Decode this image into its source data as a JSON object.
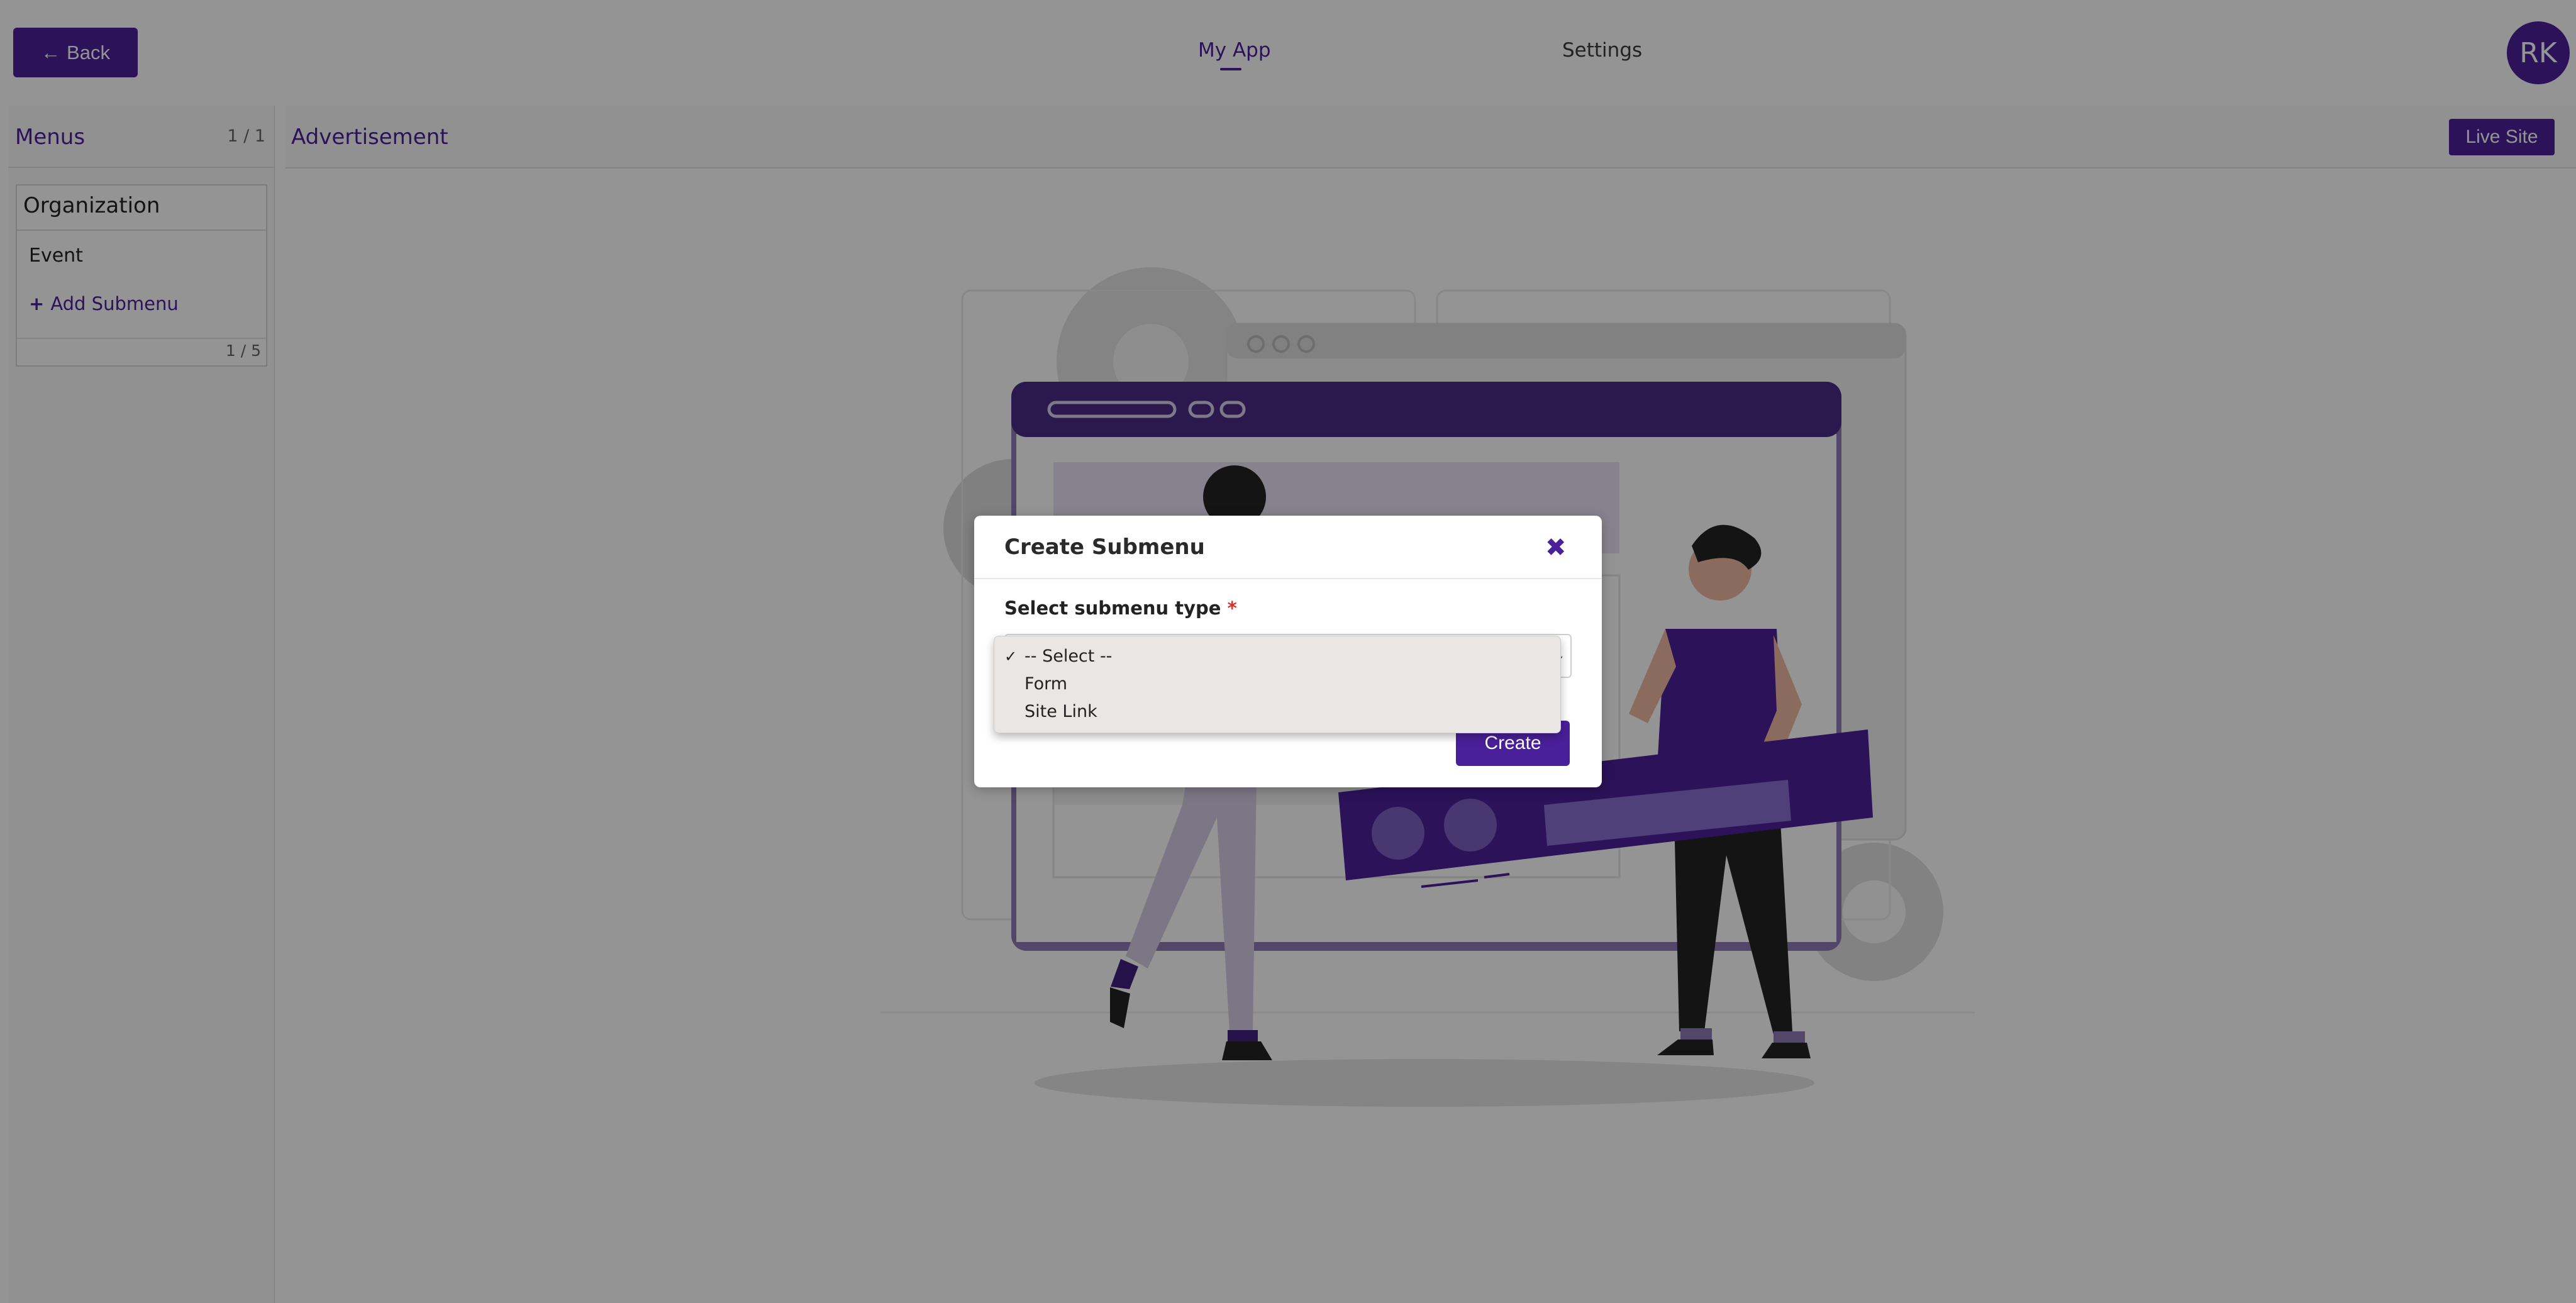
{
  "header": {
    "back_label": "Back",
    "tabs": [
      {
        "label": "My App",
        "active": true
      },
      {
        "label": "Settings",
        "active": false
      }
    ],
    "avatar_initials": "RK"
  },
  "sidebar": {
    "title": "Menus",
    "count": "1 / 1",
    "menus": [
      {
        "title": "Organization",
        "submenus": [
          "Event"
        ],
        "add_submenu_label": "Add Submenu",
        "count": "1 / 5"
      }
    ]
  },
  "main": {
    "title": "Advertisement",
    "live_site_label": "Live Site"
  },
  "modal": {
    "title": "Create Submenu",
    "close_icon": "close-icon",
    "field_label": "Select submenu type",
    "required_marker": "*",
    "select": {
      "selected": "-- Select --",
      "options": [
        "-- Select --",
        "Form",
        "Site Link"
      ]
    },
    "create_label": "Create"
  },
  "colors": {
    "accent": "#4a1f9a",
    "required": "#d62f2f",
    "overlay": "rgba(0,0,0,0.42)"
  }
}
